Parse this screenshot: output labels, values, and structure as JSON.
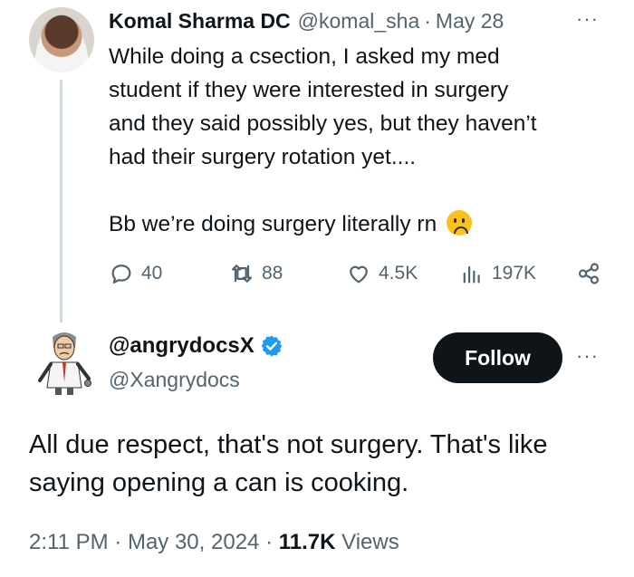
{
  "tweet1": {
    "author_name": "Komal Sharma DC",
    "handle": "@komal_sha",
    "separator": "·",
    "date": "May 28",
    "more": "···",
    "lines": [
      "While doing a csection, I asked my med",
      "student if they were interested in surgery",
      "and they said possibly yes, but they haven’t",
      "had their surgery rotation yet...."
    ],
    "last_line": "Bb we’re doing surgery literally rn",
    "emoji": "frowning-face",
    "stats": {
      "replies": "40",
      "retweets": "88",
      "likes": "4.5K",
      "views": "197K"
    }
  },
  "tweet2": {
    "author_name": "@angrydocsX",
    "handle": "@Xangrydocs",
    "follow_label": "Follow",
    "more": "···",
    "lines": [
      "All due respect, that's not surgery. That's like",
      "saying opening a can is cooking."
    ],
    "time": "2:11 PM",
    "dot1": "·",
    "date": "May 30, 2024",
    "dot2": "·",
    "views_count": "11.7K",
    "views_label": "Views"
  },
  "colors": {
    "text": "#0f1419",
    "secondary": "#536471",
    "verified": "#1d9bf0",
    "thread_line": "#cfd9de"
  }
}
